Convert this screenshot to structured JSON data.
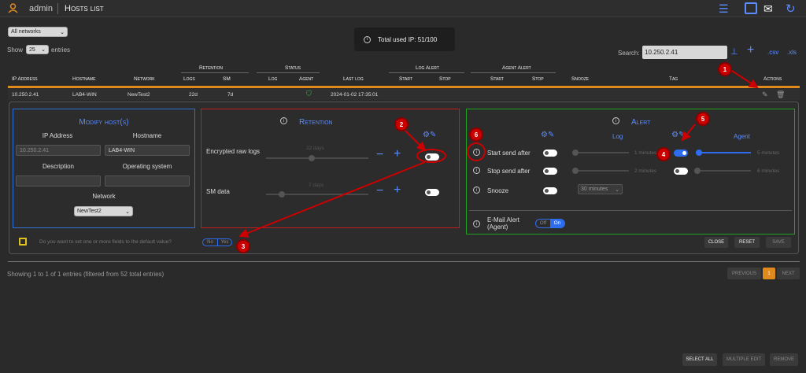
{
  "header": {
    "user": "admin",
    "title": "Hosts list"
  },
  "controls": {
    "network_filter": "All networks",
    "show": "Show",
    "entries_count": "25",
    "entries": "entries",
    "search_label": "Search:",
    "search_value": "10.250.2.41",
    "csv": ".csv",
    "xls": ".xls"
  },
  "toast": {
    "text": "Total used IP: 51/100"
  },
  "table": {
    "group_headers": {
      "retention": "Retention",
      "status": "Status",
      "log_alert": "Log Alert",
      "agent_alert": "Agent Alert"
    },
    "columns": [
      "IP Address",
      "Hostname",
      "Network",
      "Logs",
      "SM",
      "Log",
      "Agent",
      "Last log",
      "Start",
      "Stop",
      "Start",
      "Stop",
      "Snooze",
      "Tag",
      "Actions"
    ],
    "row": {
      "ip": "10.250.2.41",
      "hostname": "LAB4-WIN",
      "network": "NewTest2",
      "logs": "22d",
      "sm": "7d",
      "last_log": "2024-01-02 17:35:01"
    }
  },
  "modify": {
    "title": "Modify host(s)",
    "ip_label": "IP Address",
    "ip_value": "10.250.2.41",
    "hostname_label": "Hostname",
    "hostname_value": "LAB4-WIN",
    "description_label": "Description",
    "os_label": "Operating system",
    "network_label": "Network",
    "network_value": "NewTest2"
  },
  "retention": {
    "title": "Retention",
    "row1_label": "Encrypted raw logs",
    "row1_value": "22 days",
    "row2_label": "SM data",
    "row2_value": "7 days"
  },
  "alert": {
    "title": "Alert",
    "log_header": "Log",
    "agent_header": "Agent",
    "rows": [
      {
        "label": "Start send after",
        "log_value": "1 minutes",
        "agent_value": "5 minutes"
      },
      {
        "label": "Stop send after",
        "log_value": "2 minutes",
        "agent_value": "6 minutes"
      },
      {
        "label": "Snooze",
        "snooze_value": "30 minutes"
      }
    ],
    "email_label": "E-Mail Alert (Agent)",
    "email_off": "Off",
    "email_on": "On"
  },
  "default_prompt": {
    "text": "Do you want to set one or more fields to the default value?",
    "no": "No",
    "yes": "Yes"
  },
  "buttons": {
    "close": "CLOSE",
    "reset": "RESET",
    "save": "SAVE"
  },
  "footer": {
    "info": "Showing 1 to 1 of 1 entries (filtered from 52 total entries)",
    "previous": "PREVIOUS",
    "page": "1",
    "next": "NEXT",
    "select_all": "SELECT ALL",
    "multiple_edit": "MULTIPLE EDIT",
    "remove": "REMOVE"
  },
  "markers": [
    "1",
    "2",
    "3",
    "4",
    "5",
    "6"
  ],
  "colors": {
    "accent": "#e08a1e",
    "blue": "#2e6df0",
    "modify_border": "#2f6fd6",
    "retention_border": "#c41d1d",
    "alert_border": "#1fa31f",
    "marker": "#cc0000"
  }
}
